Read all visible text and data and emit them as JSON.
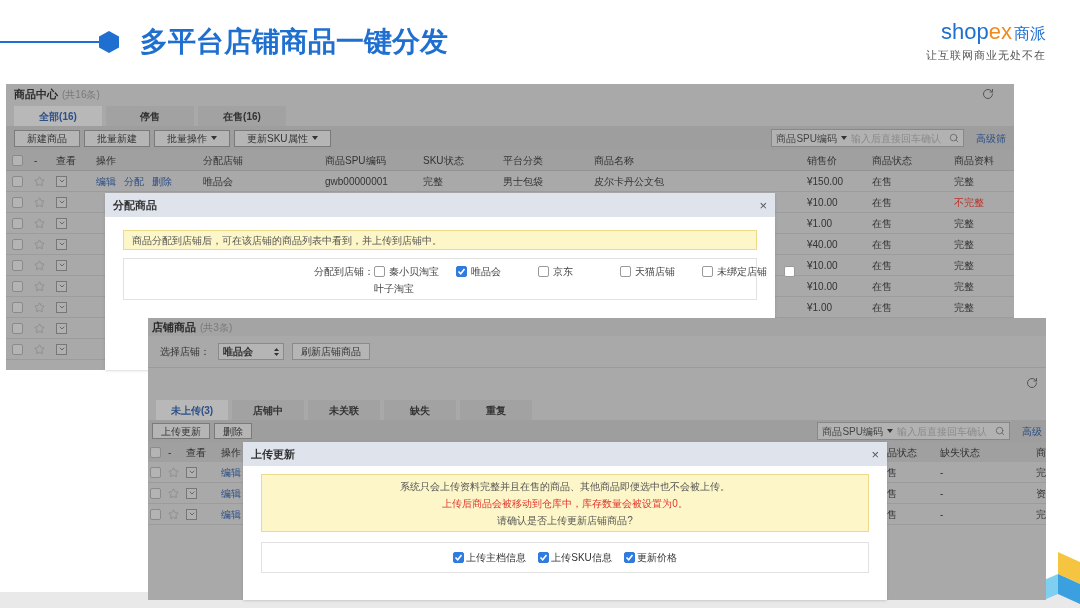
{
  "slide": {
    "title": "多平台店铺商品一键分发",
    "logo": {
      "brand": "shop",
      "brand_accent": "ex",
      "brand_cn": "商派",
      "tagline": "让互联网商业无处不在"
    }
  },
  "product_center": {
    "title": "商品中心",
    "count": "(共16条)",
    "tabs": [
      {
        "label": "全部(16)",
        "selected": true
      },
      {
        "label": "停售",
        "selected": false
      },
      {
        "label": "在售(16)",
        "selected": false
      }
    ],
    "buttons": [
      {
        "label": "新建商品",
        "kind": "plain"
      },
      {
        "label": "批量新建",
        "kind": "plain"
      },
      {
        "label": "批量操作",
        "kind": "dropdown"
      },
      {
        "label": "更新SKU属性",
        "kind": "dropdown"
      }
    ],
    "search": {
      "field": "商品SPU编码",
      "placeholder": "输入后直接回车确认"
    },
    "advanced_link": "高级筛",
    "all_checked": false,
    "columns": [
      "-",
      "查看",
      "操作",
      "分配店铺",
      "商品SPU编码",
      "SKU状态",
      "平台分类",
      "商品名称",
      "销售价",
      "商品状态",
      "商品资料"
    ],
    "rows": [
      {
        "checked": false,
        "starred": false,
        "actions": [
          "编辑",
          "分配",
          "删除"
        ],
        "store": "唯品会",
        "spu": "gwb00000001",
        "sku_status": "完整",
        "category": "男士包袋",
        "name": "皮尔卡丹公文包",
        "price": "¥150.00",
        "status": "在售",
        "info": "完整",
        "info_alert": false
      },
      {
        "checked": false,
        "starred": false,
        "price": "¥10.00",
        "status": "在售",
        "info": "不完整",
        "info_alert": true
      },
      {
        "checked": false,
        "starred": false,
        "price": "¥1.00",
        "status": "在售",
        "info": "完整",
        "info_alert": false
      },
      {
        "checked": false,
        "starred": false,
        "price": "¥40.00",
        "status": "在售",
        "info": "完整",
        "info_alert": false
      },
      {
        "checked": false,
        "starred": false,
        "price": "¥10.00",
        "status": "在售",
        "info": "完整",
        "info_alert": false
      },
      {
        "checked": false,
        "starred": false,
        "price": "¥10.00",
        "status": "在售",
        "info": "完整",
        "info_alert": false
      },
      {
        "checked": false,
        "starred": false,
        "price": "¥1.00",
        "status": "在售",
        "info": "完整",
        "info_alert": false
      },
      {
        "checked": false,
        "starred": false
      },
      {
        "checked": false,
        "starred": false
      }
    ]
  },
  "assign_dialog": {
    "title": "分配商品",
    "close": "×",
    "notice": "商品分配到店铺后，可在该店铺的商品列表中看到，并上传到店铺中。",
    "label": "分配到店铺：",
    "stores": [
      {
        "label": "秦小贝淘宝",
        "checked": false
      },
      {
        "label": "唯品会",
        "checked": true
      },
      {
        "label": "京东",
        "checked": false
      },
      {
        "label": "天猫店铺",
        "checked": false
      },
      {
        "label": "未绑定店铺",
        "checked": false
      },
      {
        "label": "叶子淘宝",
        "checked": false
      }
    ]
  },
  "store_products": {
    "title": "店铺商品",
    "count": "(共3条)",
    "store_label": "选择店铺：",
    "store_select": "唯品会",
    "refresh_button": "刷新店铺商品",
    "tabs": [
      {
        "label": "未上传(3)",
        "selected": true
      },
      {
        "label": "店铺中",
        "selected": false
      },
      {
        "label": "未关联",
        "selected": false
      },
      {
        "label": "缺失",
        "selected": false
      },
      {
        "label": "重复",
        "selected": false
      }
    ],
    "buttons": [
      "上传更新",
      "删除"
    ],
    "search": {
      "field": "商品SPU编码",
      "placeholder": "输入后直接回车确认"
    },
    "advanced_link": "高级",
    "all_checked": false,
    "columns_left": [
      "-",
      "查看",
      "操作"
    ],
    "columns_right": [
      "品状态",
      "缺失状态",
      "商"
    ],
    "rows": [
      {
        "checked": false,
        "starred": false,
        "action": "编辑",
        "status": "售",
        "missing": "-",
        "info": "完"
      },
      {
        "checked": false,
        "starred": false,
        "action": "编辑",
        "status": "售",
        "missing": "-",
        "info": "资"
      },
      {
        "checked": false,
        "starred": false,
        "action": "编辑",
        "status": "售",
        "missing": "-",
        "info": "完"
      }
    ]
  },
  "upload_dialog": {
    "title": "上传更新",
    "close": "×",
    "notice_lines": [
      {
        "text": "系统只会上传资料完整并且在售的商品、其他商品即便选中也不会被上传。",
        "kind": "info"
      },
      {
        "text": "上传后商品会被移动到仓库中，库存数量会被设置为0。",
        "kind": "warning"
      },
      {
        "text": "请确认是否上传更新店铺商品?",
        "kind": "info"
      }
    ],
    "options": [
      {
        "label": "上传主档信息",
        "checked": true
      },
      {
        "label": "上传SKU信息",
        "checked": true
      },
      {
        "label": "更新价格",
        "checked": true
      }
    ]
  }
}
